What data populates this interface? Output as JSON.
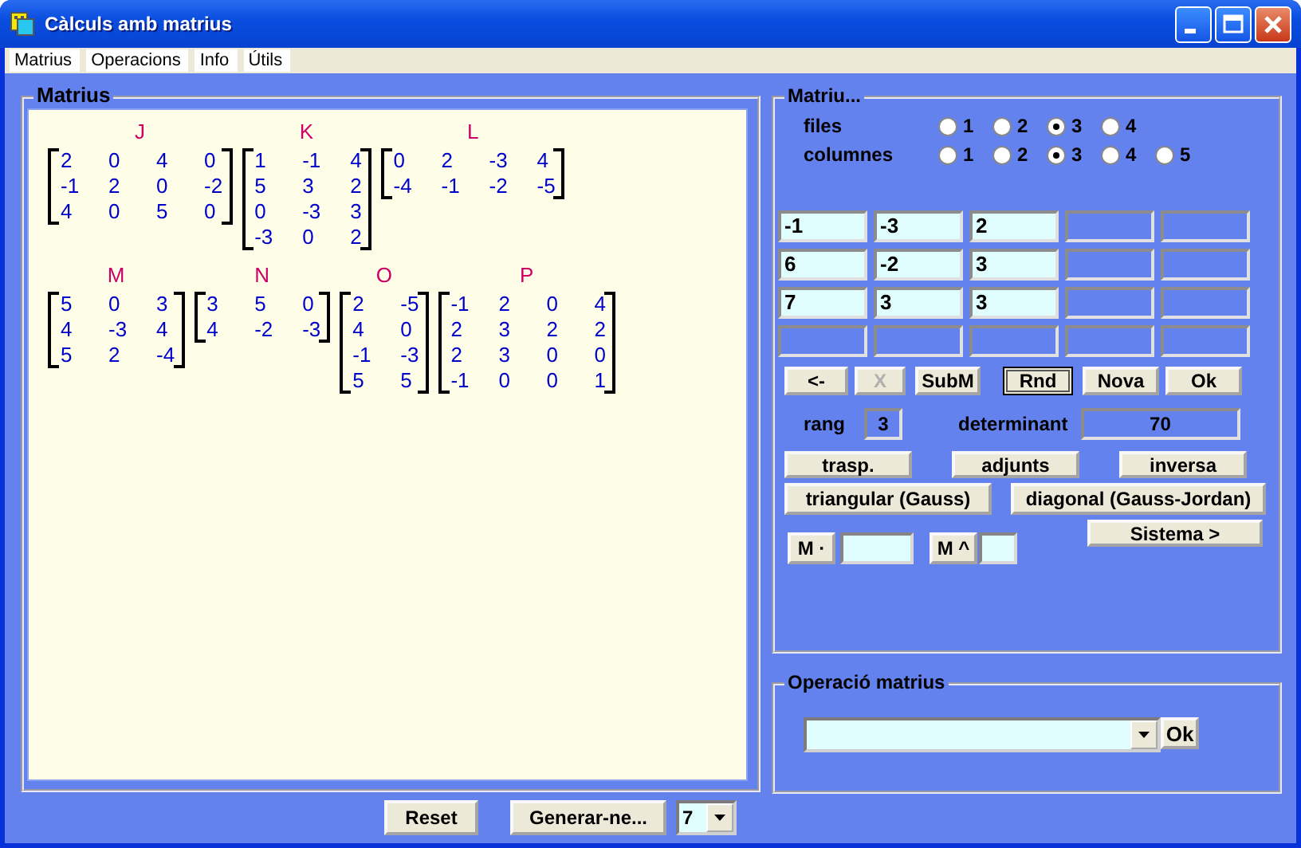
{
  "window": {
    "title": "Càlculs amb matrius"
  },
  "menu": [
    "Matrius",
    "Operacions",
    "Info",
    "Útils"
  ],
  "matrices_panel": {
    "title": "Matrius",
    "lines": [
      {
        "matrices": [
          {
            "name": "J",
            "rows": [
              [
                "2",
                "0",
                "4",
                "0"
              ],
              [
                "-1",
                "2",
                "0",
                "-2"
              ],
              [
                "4",
                "0",
                "5",
                "0"
              ]
            ]
          },
          {
            "name": "K",
            "rows": [
              [
                "1",
                "-1",
                "4"
              ],
              [
                "5",
                "3",
                "2"
              ],
              [
                "0",
                "-3",
                "3"
              ],
              [
                "-3",
                "0",
                "2"
              ]
            ]
          },
          {
            "name": "L",
            "rows": [
              [
                "0",
                "2",
                "-3",
                "4"
              ],
              [
                "-4",
                "-1",
                "-2",
                "-5"
              ]
            ]
          }
        ]
      },
      {
        "matrices": [
          {
            "name": "M",
            "rows": [
              [
                "5",
                "0",
                "3"
              ],
              [
                "4",
                "-3",
                "4"
              ],
              [
                "5",
                "2",
                "-4"
              ]
            ]
          },
          {
            "name": "N",
            "rows": [
              [
                "3",
                "5",
                "0"
              ],
              [
                "4",
                "-2",
                "-3"
              ]
            ]
          },
          {
            "name": "O",
            "rows": [
              [
                "2",
                "-5"
              ],
              [
                "4",
                "0"
              ],
              [
                "-1",
                "-3"
              ],
              [
                "5",
                "5"
              ]
            ]
          },
          {
            "name": "P",
            "rows": [
              [
                "-1",
                "2",
                "0",
                "4"
              ],
              [
                "2",
                "3",
                "2",
                "2"
              ],
              [
                "2",
                "3",
                "0",
                "0"
              ],
              [
                "-1",
                "0",
                "0",
                "1"
              ]
            ]
          }
        ]
      }
    ]
  },
  "bottom": {
    "reset": "Reset",
    "generate": "Generar-ne...",
    "count": "7"
  },
  "editor": {
    "title": "Matriu...",
    "radio_groups": [
      {
        "label": "files",
        "options": [
          {
            "label": "1",
            "selected": false
          },
          {
            "label": "2",
            "selected": false
          },
          {
            "label": "3",
            "selected": true
          },
          {
            "label": "4",
            "selected": false
          }
        ]
      },
      {
        "label": "columnes",
        "options": [
          {
            "label": "1",
            "selected": false
          },
          {
            "label": "2",
            "selected": false
          },
          {
            "label": "3",
            "selected": true
          },
          {
            "label": "4",
            "selected": false
          },
          {
            "label": "5",
            "selected": false
          }
        ]
      }
    ],
    "grid": [
      [
        {
          "value": "-1",
          "enabled": true
        },
        {
          "value": "-3",
          "enabled": true
        },
        {
          "value": "2",
          "enabled": true
        },
        {
          "enabled": false
        },
        {
          "enabled": false
        }
      ],
      [
        {
          "value": "6",
          "enabled": true
        },
        {
          "value": "-2",
          "enabled": true
        },
        {
          "value": "3",
          "enabled": true
        },
        {
          "enabled": false
        },
        {
          "enabled": false
        }
      ],
      [
        {
          "value": "7",
          "enabled": true
        },
        {
          "value": "3",
          "enabled": true
        },
        {
          "value": "3",
          "enabled": true
        },
        {
          "enabled": false
        },
        {
          "enabled": false
        }
      ],
      [
        {
          "enabled": false
        },
        {
          "enabled": false
        },
        {
          "enabled": false
        },
        {
          "enabled": false
        },
        {
          "enabled": false
        }
      ]
    ],
    "buttons": [
      {
        "label": "<-",
        "disabled": false,
        "focused": false
      },
      {
        "label": "X",
        "disabled": true,
        "focused": false
      },
      {
        "label": "SubM",
        "disabled": false,
        "focused": false
      },
      {
        "label": "Rnd",
        "disabled": false,
        "focused": true
      },
      {
        "label": "Nova",
        "disabled": false,
        "focused": false
      },
      {
        "label": "Ok",
        "disabled": false,
        "focused": false
      }
    ],
    "rank_label": "rang",
    "rank": "3",
    "det_label": "determinant",
    "det": "70",
    "ops": [
      "trasp.",
      "adjunts",
      "inversa"
    ],
    "triangular": "triangular (Gauss)",
    "diagonal": "diagonal (Gauss-Jordan)",
    "system": "Sistema >",
    "mult": "M ·",
    "power": "M ^"
  },
  "operation": {
    "title": "Operació matrius",
    "ok": "Ok"
  }
}
